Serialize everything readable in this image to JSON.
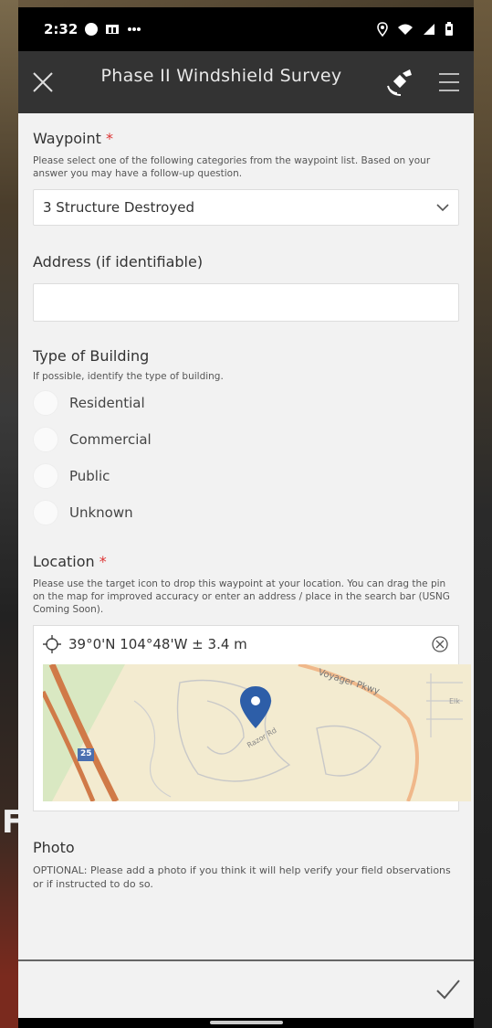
{
  "status": {
    "time": "2:32"
  },
  "app_bar": {
    "title": "Phase II Windshield Survey"
  },
  "waypoint": {
    "label": "Waypoint",
    "required_marker": "*",
    "hint": "Please select one of the following categories from the waypoint list. Based on your answer you may have a follow-up question.",
    "selected": "3 Structure Destroyed"
  },
  "address": {
    "label": "Address (if identifiable)",
    "value": ""
  },
  "building": {
    "label": "Type of Building",
    "hint": "If possible, identify the type of building.",
    "options": [
      "Residential",
      "Commercial",
      "Public",
      "Unknown"
    ]
  },
  "location": {
    "label": "Location",
    "required_marker": "*",
    "hint": "Please use the target icon to drop this waypoint at your location. You can drag the pin on the map for improved accuracy or enter an address / place in the search bar (USNG Coming Soon).",
    "coordinates": "39°0'N 104°48'W ± 3.4 m",
    "map_labels": {
      "road": "Voyager Pkwy",
      "street": "Razor Rd",
      "highway": "25",
      "area": "Elk"
    }
  },
  "photo": {
    "label": "Photo",
    "hint": "OPTIONAL: Please add a photo if you think it will help verify your field observations or if instructed to do so."
  },
  "colors": {
    "pin": "#2d5ea8",
    "accent_required": "#d33333",
    "app_bar": "#333333"
  },
  "icons": [
    "close-icon",
    "satellite-icon",
    "menu-icon",
    "chevron-down-icon",
    "crosshair-icon",
    "clear-icon",
    "map-pin-icon",
    "check-icon"
  ]
}
